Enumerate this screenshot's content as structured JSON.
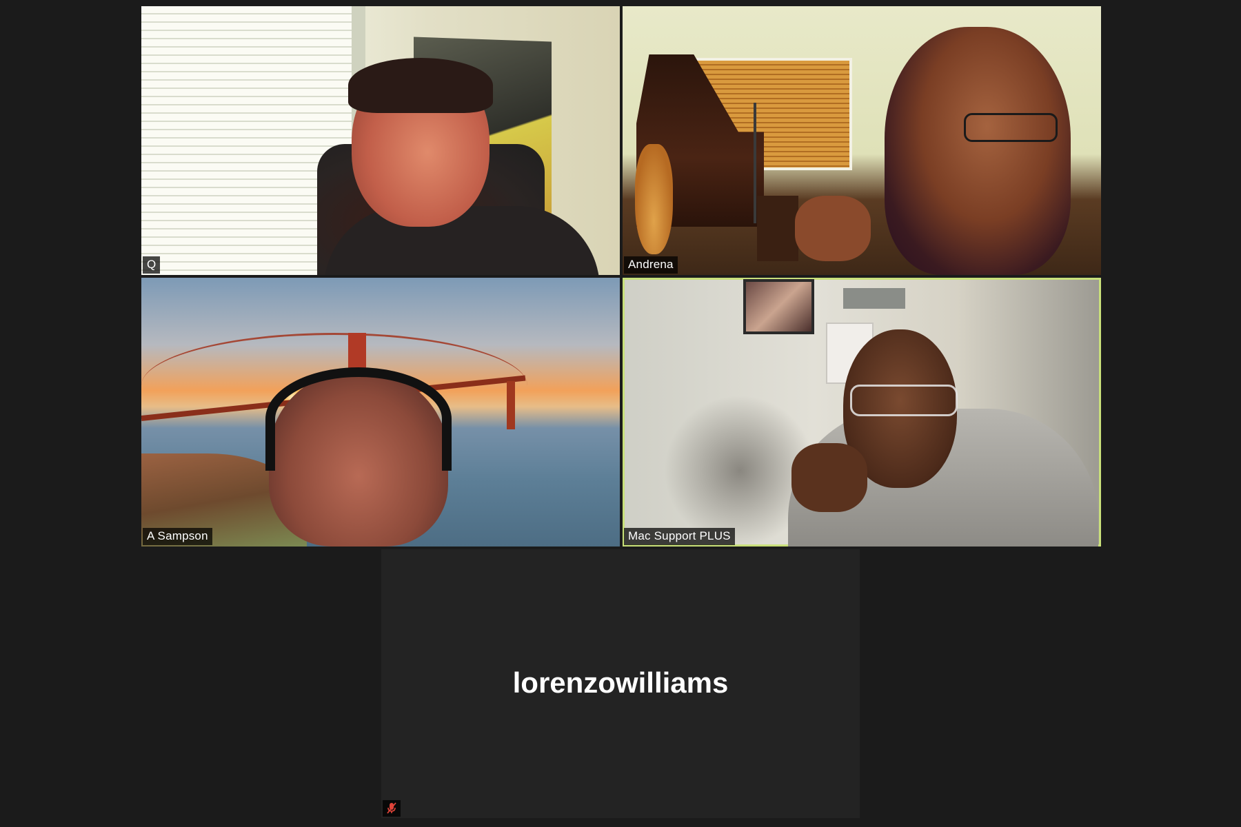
{
  "participants": [
    {
      "name": "Q",
      "video": true
    },
    {
      "name": "Andrena",
      "video": true
    },
    {
      "name": "A Sampson",
      "video": true
    },
    {
      "name": "Mac Support PLUS",
      "video": true,
      "active_speaker": true
    },
    {
      "name": "lorenzowilliams",
      "video": false,
      "muted": true
    }
  ],
  "colors": {
    "background": "#1b1b1b",
    "active_speaker_border": "#c9e07a",
    "muted_icon": "#e0443a"
  },
  "icons": {
    "mute": "microphone-muted-icon"
  }
}
